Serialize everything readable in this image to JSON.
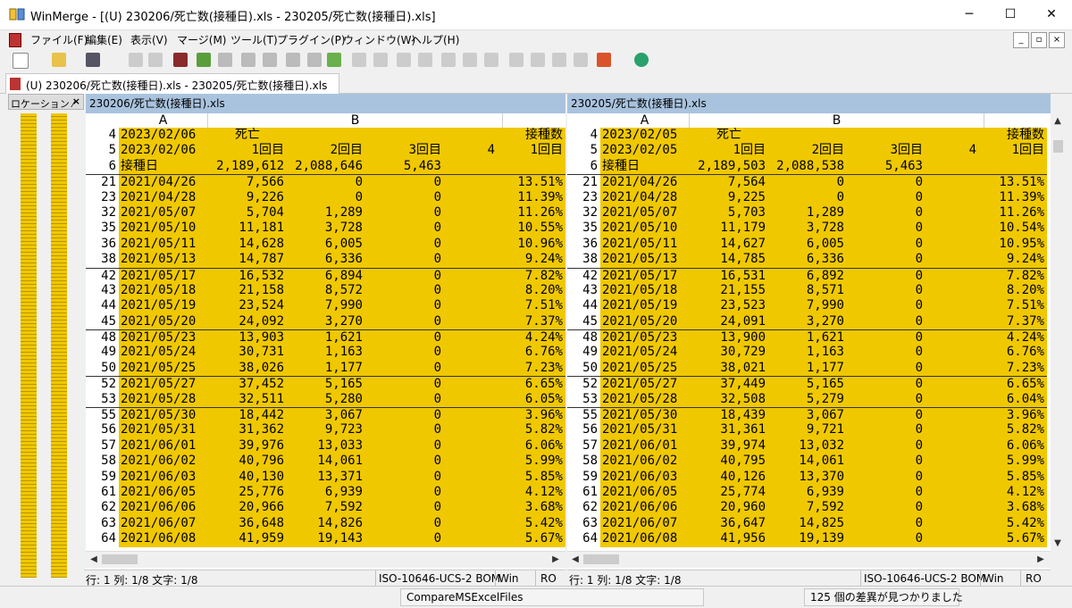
{
  "window": {
    "title": "WinMerge - [(U) 230206/死亡数(接種日).xls - 230205/死亡数(接種日).xls]",
    "min": "─",
    "max": "☐",
    "close": "✕"
  },
  "menu": [
    "ファイル(F)",
    "編集(E)",
    "表示(V)",
    "マージ(M)",
    "ツール(T)",
    "プラグイン(P)",
    "ウィンドウ(W)",
    "ヘルプ(H)"
  ],
  "tab": {
    "label": "(U) 230206/死亡数(接種日).xls - 230205/死亡数(接種日).xls"
  },
  "location_pane": {
    "title": "ロケーション ⁄",
    "close": "×"
  },
  "left": {
    "header": "230206/死亡数(接種日).xls",
    "columns": [
      "A",
      "B"
    ],
    "status": {
      "pos": "行: 1  列: 1/8  文字: 1/8",
      "encoding": "ISO-10646-UCS-2 BOM",
      "eol": "Win",
      "ro": "RO"
    },
    "rows": [
      [
        "4",
        "2023/02/06",
        "死亡",
        "",
        "",
        "",
        "接種数"
      ],
      [
        "5",
        "2023/02/06",
        "1回目",
        "2回目",
        "3回目",
        "4",
        "1回目"
      ],
      [
        "6",
        "接種日",
        "2,189,612",
        "2,088,646",
        "5,463",
        "",
        ""
      ],
      [
        "21",
        "2021/04/26",
        "7,566",
        "0",
        "0",
        "",
        "13.51%"
      ],
      [
        "23",
        "2021/04/28",
        "9,226",
        "0",
        "0",
        "",
        "11.39%"
      ],
      [
        "32",
        "2021/05/07",
        "5,704",
        "1,289",
        "0",
        "",
        "11.26%"
      ],
      [
        "35",
        "2021/05/10",
        "11,181",
        "3,728",
        "0",
        "",
        "10.55%"
      ],
      [
        "36",
        "2021/05/11",
        "14,628",
        "6,005",
        "0",
        "",
        "10.96%"
      ],
      [
        "38",
        "2021/05/13",
        "14,787",
        "6,336",
        "0",
        "",
        "9.24%"
      ],
      [
        "42",
        "2021/05/17",
        "16,532",
        "6,894",
        "0",
        "",
        "7.82%"
      ],
      [
        "43",
        "2021/05/18",
        "21,158",
        "8,572",
        "0",
        "",
        "8.20%"
      ],
      [
        "44",
        "2021/05/19",
        "23,524",
        "7,990",
        "0",
        "",
        "7.51%"
      ],
      [
        "45",
        "2021/05/20",
        "24,092",
        "3,270",
        "0",
        "",
        "7.37%"
      ],
      [
        "48",
        "2021/05/23",
        "13,903",
        "1,621",
        "0",
        "",
        "4.24%"
      ],
      [
        "49",
        "2021/05/24",
        "30,731",
        "1,163",
        "0",
        "",
        "6.76%"
      ],
      [
        "50",
        "2021/05/25",
        "38,026",
        "1,177",
        "0",
        "",
        "7.23%"
      ],
      [
        "52",
        "2021/05/27",
        "37,452",
        "5,165",
        "0",
        "",
        "6.65%"
      ],
      [
        "53",
        "2021/05/28",
        "32,511",
        "5,280",
        "0",
        "",
        "6.05%"
      ],
      [
        "55",
        "2021/05/30",
        "18,442",
        "3,067",
        "0",
        "",
        "3.96%"
      ],
      [
        "56",
        "2021/05/31",
        "31,362",
        "9,723",
        "0",
        "",
        "5.82%"
      ],
      [
        "57",
        "2021/06/01",
        "39,976",
        "13,033",
        "0",
        "",
        "6.06%"
      ],
      [
        "58",
        "2021/06/02",
        "40,796",
        "14,061",
        "0",
        "",
        "5.99%"
      ],
      [
        "59",
        "2021/06/03",
        "40,130",
        "13,371",
        "0",
        "",
        "5.85%"
      ],
      [
        "61",
        "2021/06/05",
        "25,776",
        "6,939",
        "0",
        "",
        "4.12%"
      ],
      [
        "62",
        "2021/06/06",
        "20,966",
        "7,592",
        "0",
        "",
        "3.68%"
      ],
      [
        "63",
        "2021/06/07",
        "36,648",
        "14,826",
        "0",
        "",
        "5.42%"
      ],
      [
        "64",
        "2021/06/08",
        "41,959",
        "19,143",
        "0",
        "",
        "5.67%"
      ]
    ]
  },
  "right": {
    "header": "230205/死亡数(接種日).xls",
    "columns": [
      "A",
      "B"
    ],
    "status": {
      "pos": "行: 1  列: 1/8  文字: 1/8",
      "encoding": "ISO-10646-UCS-2 BOM",
      "eol": "Win",
      "ro": "RO"
    },
    "rows": [
      [
        "4",
        "2023/02/05",
        "死亡",
        "",
        "",
        "",
        "接種数"
      ],
      [
        "5",
        "2023/02/05",
        "1回目",
        "2回目",
        "3回目",
        "4",
        "1回目"
      ],
      [
        "6",
        "接種日",
        "2,189,503",
        "2,088,538",
        "5,463",
        "",
        ""
      ],
      [
        "21",
        "2021/04/26",
        "7,564",
        "0",
        "0",
        "",
        "13.51%"
      ],
      [
        "23",
        "2021/04/28",
        "9,225",
        "0",
        "0",
        "",
        "11.39%"
      ],
      [
        "32",
        "2021/05/07",
        "5,703",
        "1,289",
        "0",
        "",
        "11.26%"
      ],
      [
        "35",
        "2021/05/10",
        "11,179",
        "3,728",
        "0",
        "",
        "10.54%"
      ],
      [
        "36",
        "2021/05/11",
        "14,627",
        "6,005",
        "0",
        "",
        "10.95%"
      ],
      [
        "38",
        "2021/05/13",
        "14,785",
        "6,336",
        "0",
        "",
        "9.24%"
      ],
      [
        "42",
        "2021/05/17",
        "16,531",
        "6,892",
        "0",
        "",
        "7.82%"
      ],
      [
        "43",
        "2021/05/18",
        "21,155",
        "8,571",
        "0",
        "",
        "8.20%"
      ],
      [
        "44",
        "2021/05/19",
        "23,523",
        "7,990",
        "0",
        "",
        "7.51%"
      ],
      [
        "45",
        "2021/05/20",
        "24,091",
        "3,270",
        "0",
        "",
        "7.37%"
      ],
      [
        "48",
        "2021/05/23",
        "13,900",
        "1,621",
        "0",
        "",
        "4.24%"
      ],
      [
        "49",
        "2021/05/24",
        "30,729",
        "1,163",
        "0",
        "",
        "6.76%"
      ],
      [
        "50",
        "2021/05/25",
        "38,021",
        "1,177",
        "0",
        "",
        "7.23%"
      ],
      [
        "52",
        "2021/05/27",
        "37,449",
        "5,165",
        "0",
        "",
        "6.65%"
      ],
      [
        "53",
        "2021/05/28",
        "32,508",
        "5,279",
        "0",
        "",
        "6.04%"
      ],
      [
        "55",
        "2021/05/30",
        "18,439",
        "3,067",
        "0",
        "",
        "3.96%"
      ],
      [
        "56",
        "2021/05/31",
        "31,361",
        "9,721",
        "0",
        "",
        "5.82%"
      ],
      [
        "57",
        "2021/06/01",
        "39,974",
        "13,032",
        "0",
        "",
        "6.06%"
      ],
      [
        "58",
        "2021/06/02",
        "40,795",
        "14,061",
        "0",
        "",
        "5.99%"
      ],
      [
        "59",
        "2021/06/03",
        "40,126",
        "13,370",
        "0",
        "",
        "5.85%"
      ],
      [
        "61",
        "2021/06/05",
        "25,774",
        "6,939",
        "0",
        "",
        "4.12%"
      ],
      [
        "62",
        "2021/06/06",
        "20,960",
        "7,592",
        "0",
        "",
        "3.68%"
      ],
      [
        "63",
        "2021/06/07",
        "36,647",
        "14,825",
        "0",
        "",
        "5.42%"
      ],
      [
        "64",
        "2021/06/08",
        "41,956",
        "19,139",
        "0",
        "",
        "5.67%"
      ]
    ]
  },
  "bottom": {
    "plugin": "CompareMSExcelFiles",
    "message": "125 個の差異が見つかりました"
  },
  "colors": {
    "diff": "#f0c800",
    "header_bar": "#a9c3de"
  }
}
